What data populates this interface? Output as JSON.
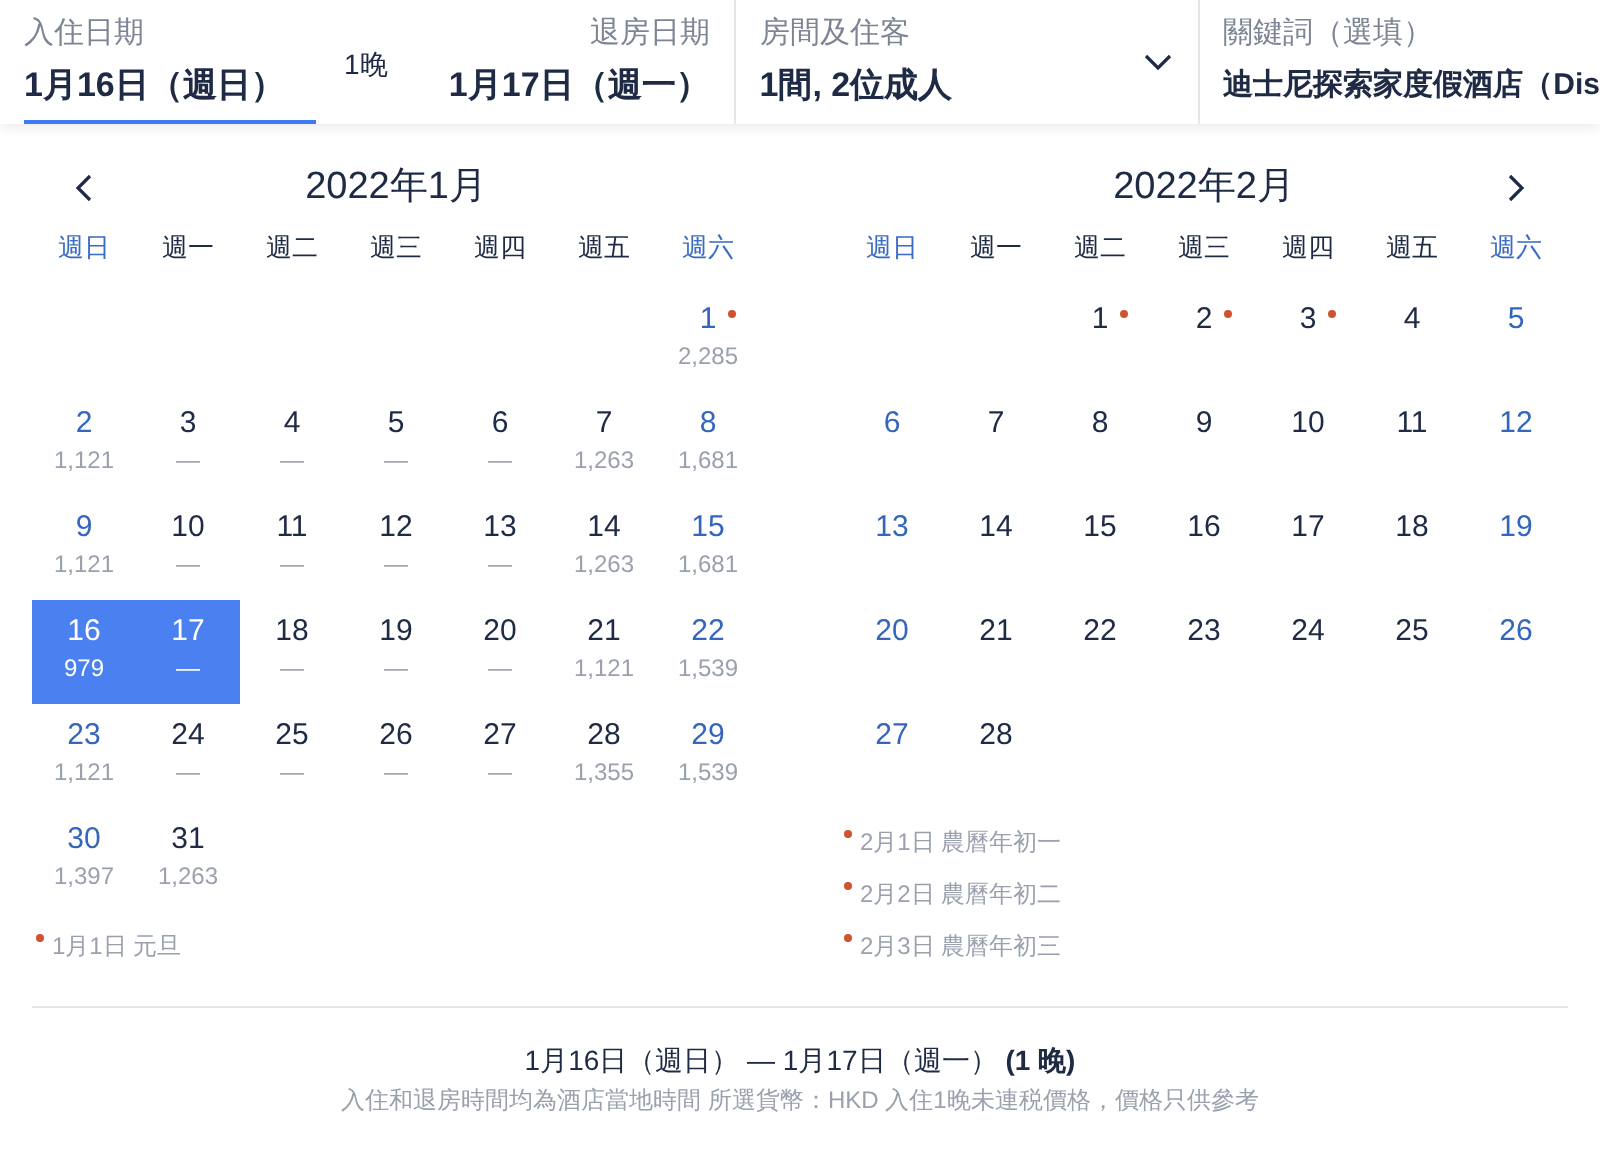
{
  "search_bar": {
    "check_in": {
      "label": "入住日期",
      "value": "1月16日（週日）",
      "selected": true
    },
    "nights": "1晚",
    "check_out": {
      "label": "退房日期",
      "value": "1月17日（週一）",
      "selected": false
    },
    "rooms": {
      "label": "房間及住客",
      "value": "1間, 2位成人"
    },
    "keyword": {
      "label": "關鍵詞（選填）",
      "value": "迪士尼探索家度假酒店（Dis"
    }
  },
  "calendars": [
    {
      "title": "2022年1月",
      "kind": "left",
      "weekdays": [
        "週日",
        "週一",
        "週二",
        "週三",
        "週四",
        "週五",
        "週六"
      ],
      "weeks": [
        [
          {
            "kind": "blank"
          },
          {
            "kind": "blank"
          },
          {
            "kind": "blank"
          },
          {
            "kind": "blank"
          },
          {
            "kind": "blank"
          },
          {
            "kind": "blank"
          },
          {
            "kind": "day",
            "day": "1",
            "price": "2,285",
            "selected": false,
            "holiday": true
          }
        ],
        [
          {
            "kind": "day",
            "day": "2",
            "price": "1,121",
            "selected": false,
            "holiday": false
          },
          {
            "kind": "day",
            "day": "3",
            "price": "—",
            "selected": false,
            "holiday": false
          },
          {
            "kind": "day",
            "day": "4",
            "price": "—",
            "selected": false,
            "holiday": false
          },
          {
            "kind": "day",
            "day": "5",
            "price": "—",
            "selected": false,
            "holiday": false
          },
          {
            "kind": "day",
            "day": "6",
            "price": "—",
            "selected": false,
            "holiday": false
          },
          {
            "kind": "day",
            "day": "7",
            "price": "1,263",
            "selected": false,
            "holiday": false
          },
          {
            "kind": "day",
            "day": "8",
            "price": "1,681",
            "selected": false,
            "holiday": false
          }
        ],
        [
          {
            "kind": "day",
            "day": "9",
            "price": "1,121",
            "selected": false,
            "holiday": false
          },
          {
            "kind": "day",
            "day": "10",
            "price": "—",
            "selected": false,
            "holiday": false
          },
          {
            "kind": "day",
            "day": "11",
            "price": "—",
            "selected": false,
            "holiday": false
          },
          {
            "kind": "day",
            "day": "12",
            "price": "—",
            "selected": false,
            "holiday": false
          },
          {
            "kind": "day",
            "day": "13",
            "price": "—",
            "selected": false,
            "holiday": false
          },
          {
            "kind": "day",
            "day": "14",
            "price": "1,263",
            "selected": false,
            "holiday": false
          },
          {
            "kind": "day",
            "day": "15",
            "price": "1,681",
            "selected": false,
            "holiday": false
          }
        ],
        [
          {
            "kind": "day",
            "day": "16",
            "price": "979",
            "selected": true,
            "holiday": false
          },
          {
            "kind": "day",
            "day": "17",
            "price": "—",
            "selected": true,
            "holiday": false
          },
          {
            "kind": "day",
            "day": "18",
            "price": "—",
            "selected": false,
            "holiday": false
          },
          {
            "kind": "day",
            "day": "19",
            "price": "—",
            "selected": false,
            "holiday": false
          },
          {
            "kind": "day",
            "day": "20",
            "price": "—",
            "selected": false,
            "holiday": false
          },
          {
            "kind": "day",
            "day": "21",
            "price": "1,121",
            "selected": false,
            "holiday": false
          },
          {
            "kind": "day",
            "day": "22",
            "price": "1,539",
            "selected": false,
            "holiday": false
          }
        ],
        [
          {
            "kind": "day",
            "day": "23",
            "price": "1,121",
            "selected": false,
            "holiday": false
          },
          {
            "kind": "day",
            "day": "24",
            "price": "—",
            "selected": false,
            "holiday": false
          },
          {
            "kind": "day",
            "day": "25",
            "price": "—",
            "selected": false,
            "holiday": false
          },
          {
            "kind": "day",
            "day": "26",
            "price": "—",
            "selected": false,
            "holiday": false
          },
          {
            "kind": "day",
            "day": "27",
            "price": "—",
            "selected": false,
            "holiday": false
          },
          {
            "kind": "day",
            "day": "28",
            "price": "1,355",
            "selected": false,
            "holiday": false
          },
          {
            "kind": "day",
            "day": "29",
            "price": "1,539",
            "selected": false,
            "holiday": false
          }
        ],
        [
          {
            "kind": "day",
            "day": "30",
            "price": "1,397",
            "selected": false,
            "holiday": false
          },
          {
            "kind": "day",
            "day": "31",
            "price": "1,263",
            "selected": false,
            "holiday": false
          }
        ]
      ],
      "holidays": [
        "1月1日 元旦"
      ]
    },
    {
      "title": "2022年2月",
      "kind": "right",
      "weekdays": [
        "週日",
        "週一",
        "週二",
        "週三",
        "週四",
        "週五",
        "週六"
      ],
      "weeks": [
        [
          {
            "kind": "blank"
          },
          {
            "kind": "blank"
          },
          {
            "kind": "day",
            "day": "1",
            "selected": false,
            "holiday": true
          },
          {
            "kind": "day",
            "day": "2",
            "selected": false,
            "holiday": true
          },
          {
            "kind": "day",
            "day": "3",
            "selected": false,
            "holiday": true
          },
          {
            "kind": "day",
            "day": "4",
            "selected": false,
            "holiday": false
          },
          {
            "kind": "day",
            "day": "5",
            "selected": false,
            "holiday": false
          }
        ],
        [
          {
            "kind": "day",
            "day": "6",
            "selected": false,
            "holiday": false
          },
          {
            "kind": "day",
            "day": "7",
            "selected": false,
            "holiday": false
          },
          {
            "kind": "day",
            "day": "8",
            "selected": false,
            "holiday": false
          },
          {
            "kind": "day",
            "day": "9",
            "selected": false,
            "holiday": false
          },
          {
            "kind": "day",
            "day": "10",
            "selected": false,
            "holiday": false
          },
          {
            "kind": "day",
            "day": "11",
            "selected": false,
            "holiday": false
          },
          {
            "kind": "day",
            "day": "12",
            "selected": false,
            "holiday": false
          }
        ],
        [
          {
            "kind": "day",
            "day": "13",
            "selected": false,
            "holiday": false
          },
          {
            "kind": "day",
            "day": "14",
            "selected": false,
            "holiday": false
          },
          {
            "kind": "day",
            "day": "15",
            "selected": false,
            "holiday": false
          },
          {
            "kind": "day",
            "day": "16",
            "selected": false,
            "holiday": false
          },
          {
            "kind": "day",
            "day": "17",
            "selected": false,
            "holiday": false
          },
          {
            "kind": "day",
            "day": "18",
            "selected": false,
            "holiday": false
          },
          {
            "kind": "day",
            "day": "19",
            "selected": false,
            "holiday": false
          }
        ],
        [
          {
            "kind": "day",
            "day": "20",
            "selected": false,
            "holiday": false
          },
          {
            "kind": "day",
            "day": "21",
            "selected": false,
            "holiday": false
          },
          {
            "kind": "day",
            "day": "22",
            "selected": false,
            "holiday": false
          },
          {
            "kind": "day",
            "day": "23",
            "selected": false,
            "holiday": false
          },
          {
            "kind": "day",
            "day": "24",
            "selected": false,
            "holiday": false
          },
          {
            "kind": "day",
            "day": "25",
            "selected": false,
            "holiday": false
          },
          {
            "kind": "day",
            "day": "26",
            "selected": false,
            "holiday": false
          }
        ],
        [
          {
            "kind": "day",
            "day": "27",
            "selected": false,
            "holiday": false
          },
          {
            "kind": "day",
            "day": "28",
            "selected": false,
            "holiday": false
          }
        ]
      ],
      "holidays": [
        "2月1日 農曆年初一",
        "2月2日 農曆年初二",
        "2月3日 農曆年初三"
      ]
    }
  ],
  "footer": {
    "summary": "1月16日（週日） — 1月17日（週一） **(1 晚)**",
    "note": "入住和退房時間均為酒店當地時間 所選貨幣：HKD 入住1晚未連税價格，價格只供參考"
  }
}
